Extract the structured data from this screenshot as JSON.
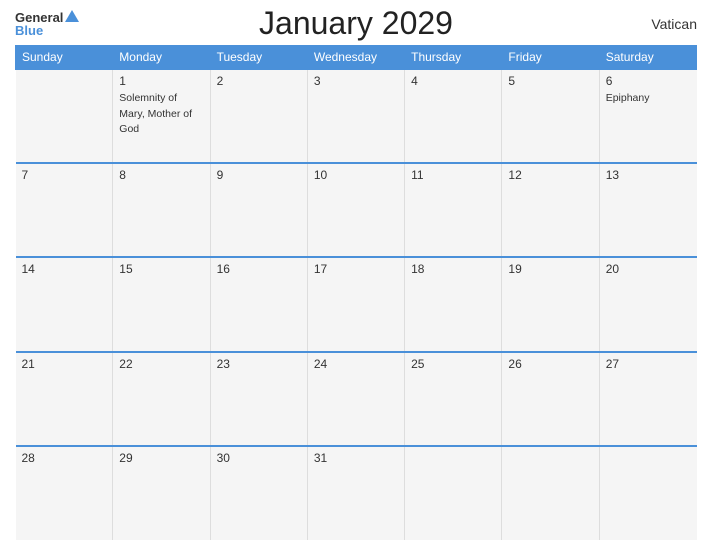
{
  "header": {
    "title": "January 2029",
    "country": "Vatican",
    "logo_general": "General",
    "logo_blue": "Blue"
  },
  "weekdays": [
    "Sunday",
    "Monday",
    "Tuesday",
    "Wednesday",
    "Thursday",
    "Friday",
    "Saturday"
  ],
  "weeks": [
    [
      {
        "day": "",
        "event": ""
      },
      {
        "day": "1",
        "event": "Solemnity of Mary,\nMother of God"
      },
      {
        "day": "2",
        "event": ""
      },
      {
        "day": "3",
        "event": ""
      },
      {
        "day": "4",
        "event": ""
      },
      {
        "day": "5",
        "event": ""
      },
      {
        "day": "6",
        "event": "Epiphany"
      }
    ],
    [
      {
        "day": "7",
        "event": ""
      },
      {
        "day": "8",
        "event": ""
      },
      {
        "day": "9",
        "event": ""
      },
      {
        "day": "10",
        "event": ""
      },
      {
        "day": "11",
        "event": ""
      },
      {
        "day": "12",
        "event": ""
      },
      {
        "day": "13",
        "event": ""
      }
    ],
    [
      {
        "day": "14",
        "event": ""
      },
      {
        "day": "15",
        "event": ""
      },
      {
        "day": "16",
        "event": ""
      },
      {
        "day": "17",
        "event": ""
      },
      {
        "day": "18",
        "event": ""
      },
      {
        "day": "19",
        "event": ""
      },
      {
        "day": "20",
        "event": ""
      }
    ],
    [
      {
        "day": "21",
        "event": ""
      },
      {
        "day": "22",
        "event": ""
      },
      {
        "day": "23",
        "event": ""
      },
      {
        "day": "24",
        "event": ""
      },
      {
        "day": "25",
        "event": ""
      },
      {
        "day": "26",
        "event": ""
      },
      {
        "day": "27",
        "event": ""
      }
    ],
    [
      {
        "day": "28",
        "event": ""
      },
      {
        "day": "29",
        "event": ""
      },
      {
        "day": "30",
        "event": ""
      },
      {
        "day": "31",
        "event": ""
      },
      {
        "day": "",
        "event": ""
      },
      {
        "day": "",
        "event": ""
      },
      {
        "day": "",
        "event": ""
      }
    ]
  ]
}
